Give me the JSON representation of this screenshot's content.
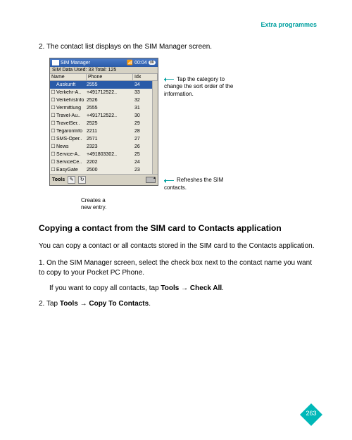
{
  "header": "Extra programmes",
  "step2_num": "2.",
  "step2_text": "The contact list displays on the SIM Manager screen.",
  "shot": {
    "title": "SIM Manager",
    "clock": "00:04",
    "simline": "SIM Data  Used: 33  Total: 125",
    "cols": {
      "name": "Name",
      "phone": "Phone",
      "idx": "Idx"
    },
    "rows": [
      {
        "name": "Auskunft",
        "phone": "2555",
        "idx": "34",
        "sel": true
      },
      {
        "name": "Verkehr-A..",
        "phone": "+491712522..",
        "idx": "33"
      },
      {
        "name": "VerkehrsInfo",
        "phone": "2526",
        "idx": "32"
      },
      {
        "name": "Vermittlung",
        "phone": "2555",
        "idx": "31"
      },
      {
        "name": "Travel-Au..",
        "phone": "+491712522..",
        "idx": "30"
      },
      {
        "name": "TravelSer..",
        "phone": "2525",
        "idx": "29"
      },
      {
        "name": "TegaronInfo",
        "phone": "2211",
        "idx": "28"
      },
      {
        "name": "SMS-Oper..",
        "phone": "2571",
        "idx": "27"
      },
      {
        "name": "News",
        "phone": "2323",
        "idx": "26"
      },
      {
        "name": "Service-A..",
        "phone": "+491803302..",
        "idx": "25"
      },
      {
        "name": "ServiceCe..",
        "phone": "2202",
        "idx": "24"
      },
      {
        "name": "EasyGate",
        "phone": "2500",
        "idx": "23"
      }
    ],
    "tools": "Tools",
    "btn_new": "✎",
    "btn_refresh": "↻"
  },
  "callout_sort": "Tap the category to change the sort order of the information.",
  "callout_refresh": "Refreshes the SIM contacts.",
  "callout_new": "Creates a new entry.",
  "subhead": "Copying a contact from the SIM card to Contacts application",
  "para1": "You can copy a contact or all contacts stored in the SIM card to the Contacts application.",
  "s1_num": "1.",
  "s1_text": "On the SIM Manager screen, select the check box next to the contact name you want to copy to your Pocket PC Phone.",
  "s1_extra_a": "If you want to copy all contacts, tap ",
  "s1_tools": "Tools",
  "s1_arrow": " → ",
  "s1_checkall": "Check All",
  "s2_num": "2.",
  "s2_text_a": "Tap ",
  "s2_tools": "Tools",
  "s2_arrow": " → ",
  "s2_copy": "Copy To Contacts",
  "page": "263"
}
